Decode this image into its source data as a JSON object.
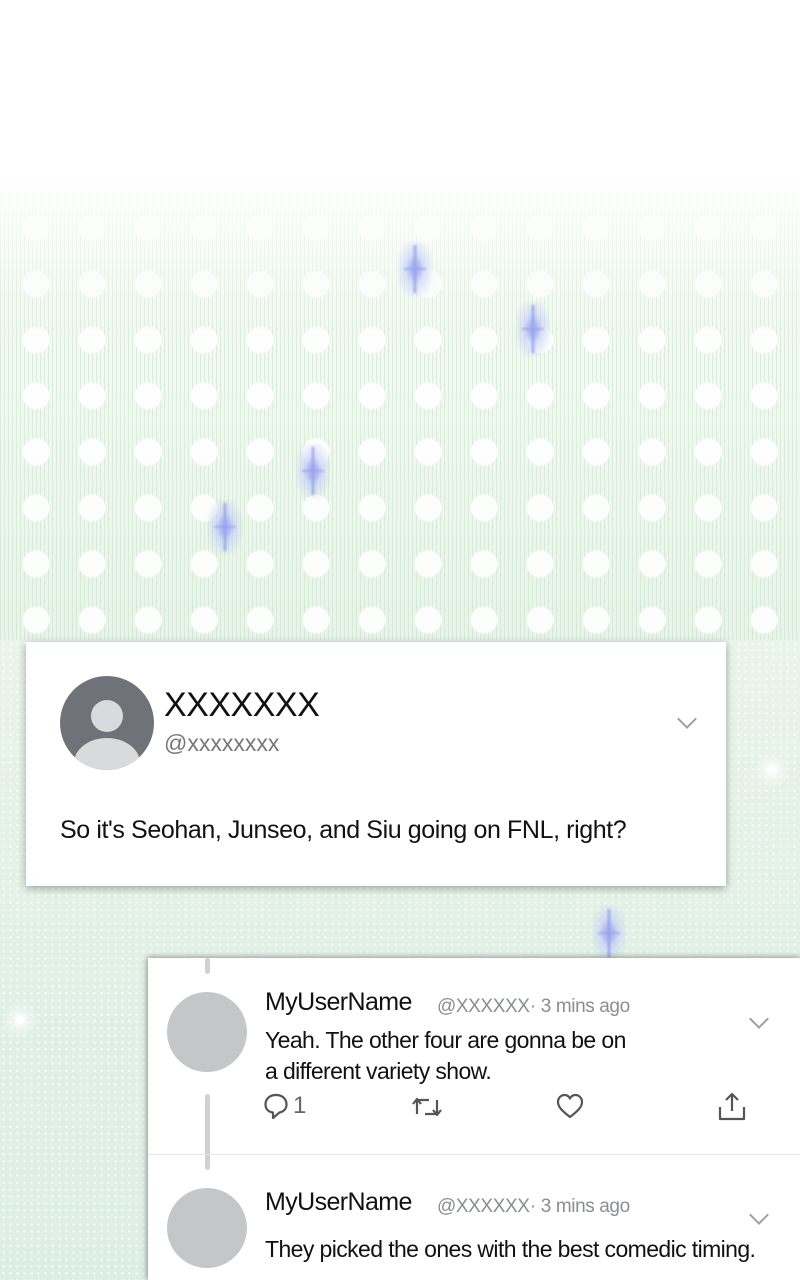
{
  "tweet": {
    "display_name": "XXXXXXX",
    "handle": "@xxxxxxxx",
    "text": "So it's Seohan, Junseo, and Siu going on FNL, right?"
  },
  "replies": [
    {
      "name": "MyUserName",
      "handle": "@XXXXXX",
      "time": "· 3 mins ago",
      "lines": [
        "Yeah. The other four are gonna be on",
        "a different variety show."
      ],
      "reply_count": "1"
    },
    {
      "name": "MyUserName",
      "handle": "@XXXXXX",
      "time": "· 3 mins ago",
      "lines": [
        "They picked the ones with the best comedic timing."
      ]
    }
  ],
  "icons": {
    "avatar": "default-profile-icon",
    "more": "chevron-down-icon",
    "reply": "reply-icon",
    "retweet": "retweet-icon",
    "like": "heart-icon",
    "share": "share-icon"
  },
  "colors": {
    "avatar_dark": "#6f7278",
    "avatar_light": "#c4c6c8",
    "meta_text": "#8a8d91",
    "background_tint": "#e3f1e6"
  }
}
